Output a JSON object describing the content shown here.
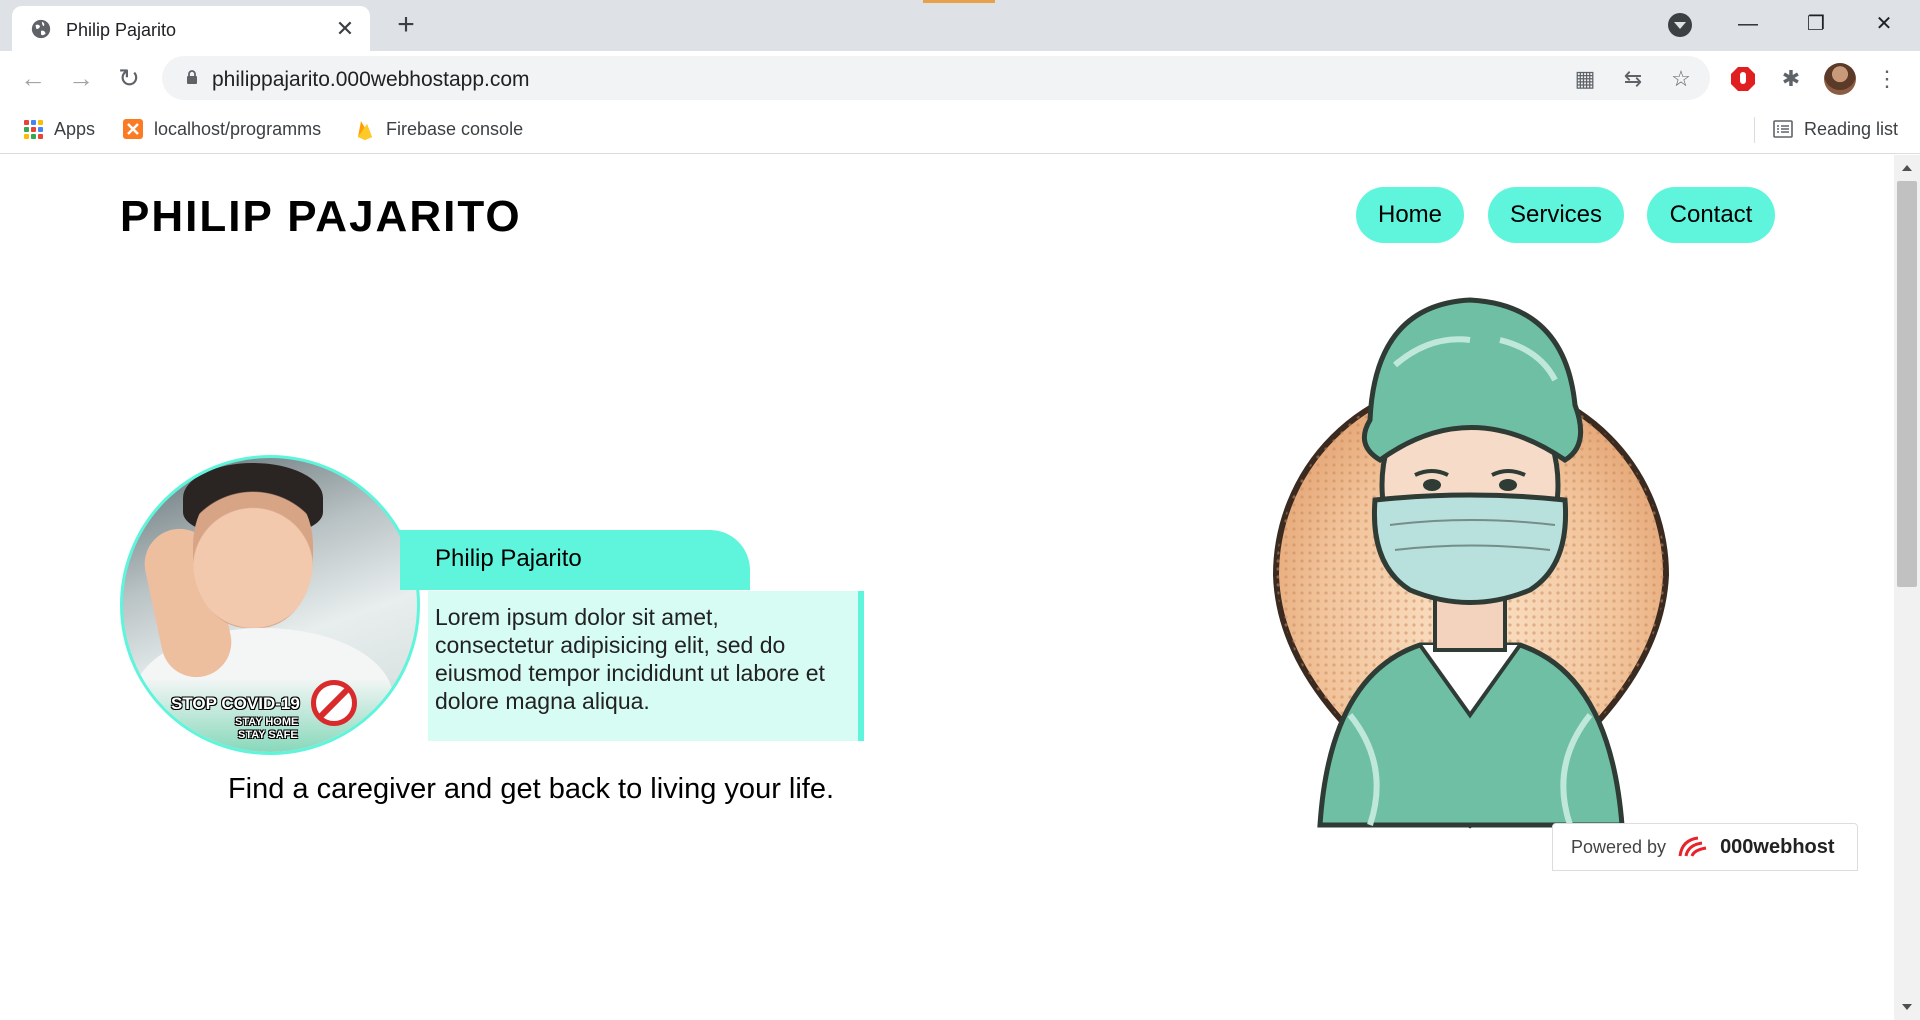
{
  "browser": {
    "tab_title": "Philip Pajarito",
    "close_glyph": "✕",
    "new_tab_glyph": "+",
    "url": "philippajarito.000webhostapp.com",
    "window_controls": {
      "minimize": "—",
      "restore": "❐",
      "close": "✕"
    },
    "nav": {
      "back": "←",
      "forward": "→",
      "reload": "↻"
    },
    "omnibox_icons": {
      "qr": "▦",
      "translate": "⇆",
      "bookmark": "☆"
    },
    "extensions": {
      "puzzle": "✱",
      "menu": "⋮"
    },
    "bookmarks": [
      {
        "label": "Apps",
        "icon": "apps-grid-icon"
      },
      {
        "label": "localhost/programms",
        "icon": "xampp-icon"
      },
      {
        "label": "Firebase console",
        "icon": "firebase-icon"
      }
    ],
    "reading_list": "Reading list"
  },
  "site": {
    "title": "PHILIP PAJARITO",
    "nav": [
      "Home",
      "Services",
      "Contact"
    ],
    "profile": {
      "covid_title": "STOP COVID-19",
      "covid_line1": "STAY HOME",
      "covid_line2": "STAY SAFE",
      "name": "Philip Pajarito",
      "description": "Lorem ipsum dolor sit amet, consectetur adipisicing elit, sed do eiusmod tempor incididunt ut labore et dolore magna aliqua."
    },
    "tagline": "Find a caregiver and get back to living your life.",
    "powered_by": "Powered by",
    "powered_brand": "000webhost"
  },
  "colors": {
    "accent": "#5ef5dc",
    "accent_light": "#d6fcf3",
    "scrub_green": "#6fbfa5"
  }
}
